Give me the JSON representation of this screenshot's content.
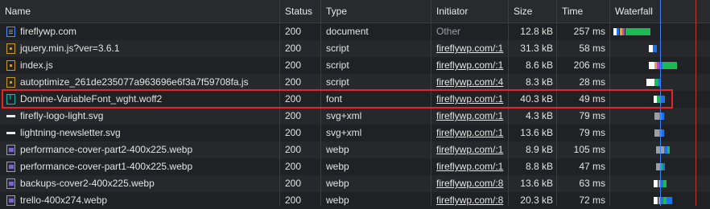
{
  "columns": {
    "name": "Name",
    "status": "Status",
    "type": "Type",
    "initiator": "Initiator",
    "size": "Size",
    "time": "Time",
    "waterfall": "Waterfall"
  },
  "rows": [
    {
      "name": "fireflywp.com",
      "status": "200",
      "type": "document",
      "initiator": "Other",
      "size": "12.8 kB",
      "time": "257 ms",
      "icon": "document-icon"
    },
    {
      "name": "jquery.min.js?ver=3.6.1",
      "status": "200",
      "type": "script",
      "initiator": "fireflywp.com/:1",
      "size": "31.3 kB",
      "time": "58 ms",
      "icon": "script-icon"
    },
    {
      "name": "index.js",
      "status": "200",
      "type": "script",
      "initiator": "fireflywp.com/:1",
      "size": "8.6 kB",
      "time": "206 ms",
      "icon": "script-icon"
    },
    {
      "name": "autoptimize_261de235077a963696e6f3a7f59708fa.js",
      "status": "200",
      "type": "script",
      "initiator": "fireflywp.com/:4",
      "size": "8.3 kB",
      "time": "28 ms",
      "icon": "script-icon"
    },
    {
      "name": "Domine-VariableFont_wght.woff2",
      "status": "200",
      "type": "font",
      "initiator": "fireflywp.com/:1",
      "size": "40.3 kB",
      "time": "49 ms",
      "icon": "font-icon"
    },
    {
      "name": "firefly-logo-light.svg",
      "status": "200",
      "type": "svg+xml",
      "initiator": "fireflywp.com/:1",
      "size": "4.3 kB",
      "time": "79 ms",
      "icon": "svg-icon"
    },
    {
      "name": "lightning-newsletter.svg",
      "status": "200",
      "type": "svg+xml",
      "initiator": "fireflywp.com/:1",
      "size": "13.6 kB",
      "time": "79 ms",
      "icon": "svg-icon"
    },
    {
      "name": "performance-cover-part2-400x225.webp",
      "status": "200",
      "type": "webp",
      "initiator": "fireflywp.com/:1",
      "size": "8.9 kB",
      "time": "105 ms",
      "icon": "image-icon"
    },
    {
      "name": "performance-cover-part1-400x225.webp",
      "status": "200",
      "type": "webp",
      "initiator": "fireflywp.com/:1",
      "size": "8.8 kB",
      "time": "47 ms",
      "icon": "image-icon"
    },
    {
      "name": "backups-cover2-400x225.webp",
      "status": "200",
      "type": "webp",
      "initiator": "fireflywp.com/:8",
      "size": "13.6 kB",
      "time": "63 ms",
      "icon": "image-icon"
    },
    {
      "name": "trello-400x274.webp",
      "status": "200",
      "type": "webp",
      "initiator": "fireflywp.com/:8",
      "size": "20.3 kB",
      "time": "72 ms",
      "icon": "image-icon"
    }
  ],
  "selected_row": 4,
  "colors": {
    "highlight": "#e8232a",
    "dom_content_loaded": "#3b82f6",
    "load_event": "#c0392b",
    "waiting": "#1db954",
    "download": "#1a73e8"
  }
}
